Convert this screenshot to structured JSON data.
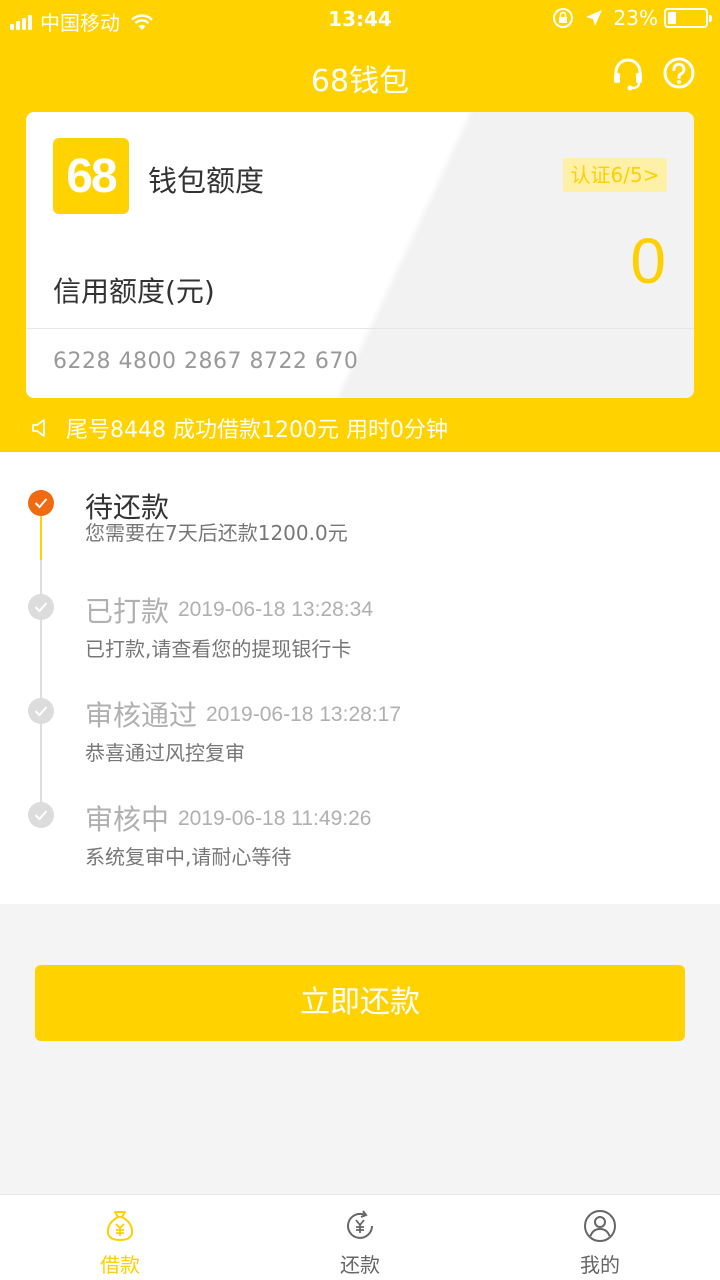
{
  "status_bar": {
    "carrier": "中国移动",
    "time": "13:44",
    "battery": "23%"
  },
  "nav": {
    "title": "68钱包"
  },
  "card": {
    "logo_text": "68",
    "wallet_title": "钱包额度",
    "cert_badge": "认证6/5>",
    "credit_label": "信用额度(元)",
    "credit_amount": "0",
    "card_number": "6228 4800 2867 8722 670"
  },
  "notice": "尾号8448 成功借款1200元 用时0分钟",
  "timeline": [
    {
      "title": "待还款",
      "time": "",
      "desc": "您需要在7天后还款1200.0元",
      "state": "active"
    },
    {
      "title": "已打款",
      "time": "2019-06-18 13:28:34",
      "desc": "已打款,请查看您的提现银行卡",
      "state": "done"
    },
    {
      "title": "审核通过",
      "time": "2019-06-18 13:28:17",
      "desc": "恭喜通过风控复审",
      "state": "done"
    },
    {
      "title": "审核中",
      "time": "2019-06-18 11:49:26",
      "desc": "系统复审中,请耐心等待",
      "state": "done"
    }
  ],
  "repay_button": "立即还款",
  "tabs": [
    {
      "label": "借款",
      "icon": "money-bag-icon",
      "active": true
    },
    {
      "label": "还款",
      "icon": "yuan-refresh-icon",
      "active": false
    },
    {
      "label": "我的",
      "icon": "user-icon",
      "active": false
    }
  ],
  "colors": {
    "brand_yellow": "#ffd200",
    "active_orange": "#f06a12",
    "amount_yellow": "#ffd000"
  }
}
